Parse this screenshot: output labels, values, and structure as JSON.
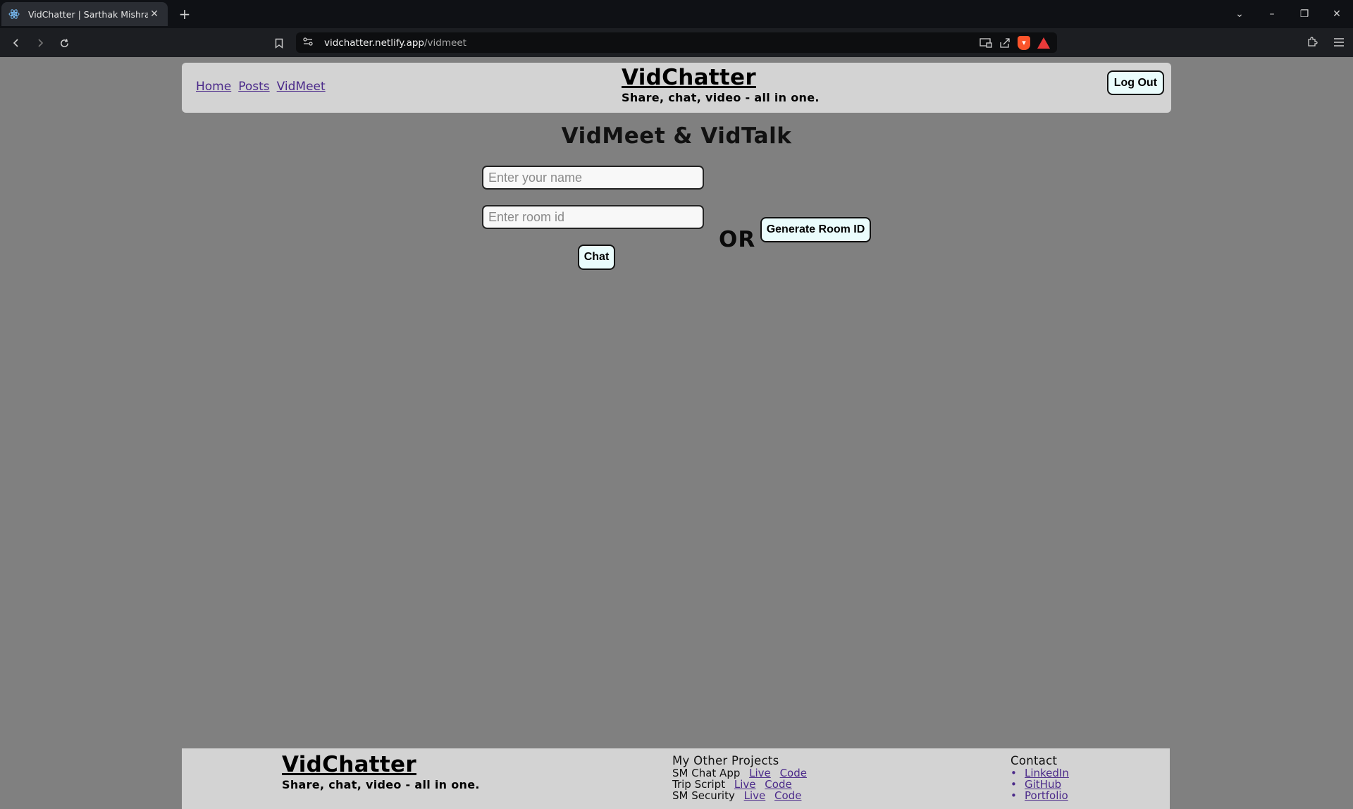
{
  "browser": {
    "tab_title": "VidChatter | Sarthak Mishra",
    "tab_close_glyph": "✕",
    "new_tab_glyph": "+",
    "url_host": "vidchatter.netlify.app",
    "url_path": "/vidmeet",
    "icons": [
      "react-favicon-icon",
      "back-icon",
      "forward-icon",
      "reload-icon",
      "bookmark-icon",
      "site-info-icon",
      "cast-icon",
      "share-icon",
      "brave-shields-icon",
      "brave-rewards-icon",
      "extensions-icon",
      "menu-icon"
    ]
  },
  "header": {
    "nav": [
      "Home",
      "Posts",
      "VidMeet"
    ],
    "brand_title": "VidChatter",
    "brand_tagline": "Share, chat, video - all in one.",
    "logout_label": "Log Out"
  },
  "main": {
    "heading": "VidMeet & VidTalk",
    "name_placeholder": "Enter your name",
    "room_placeholder": "Enter room id",
    "chat_label": "Chat",
    "or_label": "OR",
    "generate_label": "Generate Room ID"
  },
  "footer": {
    "brand_title": "VidChatter",
    "brand_tagline": "Share, chat, video - all in one.",
    "projects_heading": "My Other Projects",
    "projects": [
      {
        "name": "SM Chat App",
        "live": "Live",
        "code": "Code"
      },
      {
        "name": "Trip Script",
        "live": "Live",
        "code": "Code"
      },
      {
        "name": "SM Security",
        "live": "Live",
        "code": "Code"
      }
    ],
    "contact_heading": "Contact",
    "contacts": [
      "LinkedIn",
      "GitHub",
      "Portfolio"
    ]
  },
  "colors": {
    "page_bg": "#808080",
    "panel_bg": "#d3d3d3",
    "link": "#4b2a8a",
    "button_bg": "#eafcfc"
  }
}
